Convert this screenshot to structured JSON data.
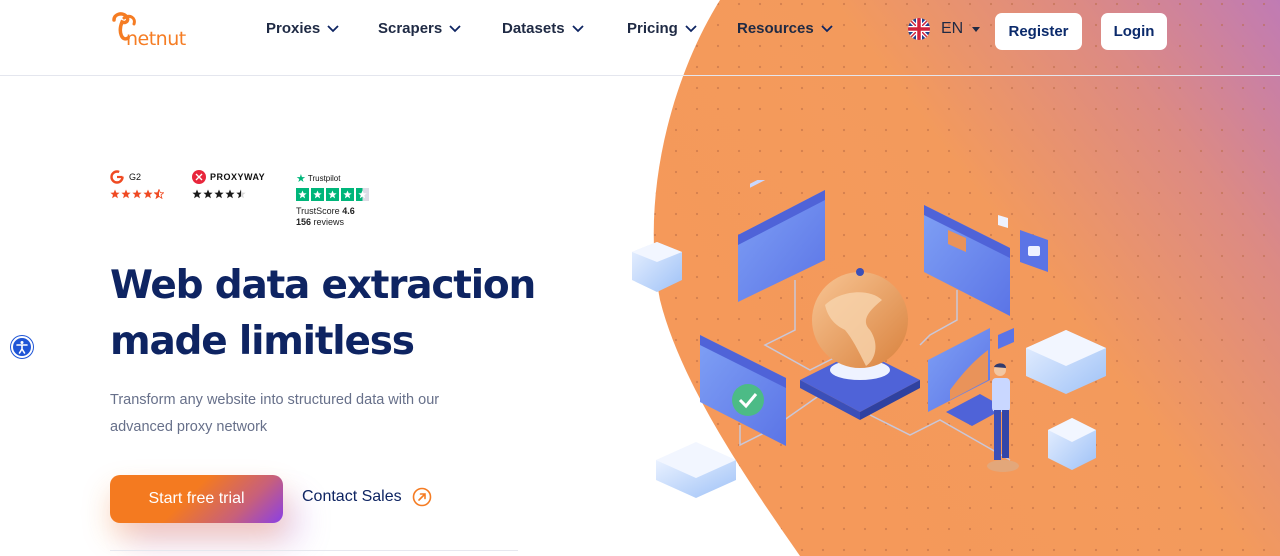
{
  "brand": {
    "name": "netnut",
    "accent": "#f57c23",
    "navy": "#0e2462"
  },
  "nav": {
    "items": [
      {
        "label": "Proxies"
      },
      {
        "label": "Scrapers"
      },
      {
        "label": "Datasets"
      },
      {
        "label": "Pricing"
      },
      {
        "label": "Resources"
      }
    ],
    "language": "EN",
    "register_label": "Register",
    "login_label": "Login"
  },
  "ratings": {
    "g2": {
      "label": "G2",
      "stars": 4.5
    },
    "proxyway": {
      "label": "PROXYWAY",
      "stars": 4.5
    },
    "trustpilot": {
      "label": "Trustpilot",
      "stars": 4.5,
      "score_label": "TrustScore",
      "score": "4.6",
      "reviews_count": "156",
      "reviews_label": "reviews"
    }
  },
  "hero": {
    "title_line1": "Web data extraction",
    "title_line2": "made limitless",
    "subtitle": "Transform any website into structured data with our advanced proxy network",
    "cta_primary": "Start free trial",
    "cta_secondary": "Contact Sales"
  },
  "icons": {
    "accessibility": "accessibility-icon",
    "contact_arrow": "arrow-up-right-circle-icon",
    "language_flag": "uk-flag-icon"
  }
}
